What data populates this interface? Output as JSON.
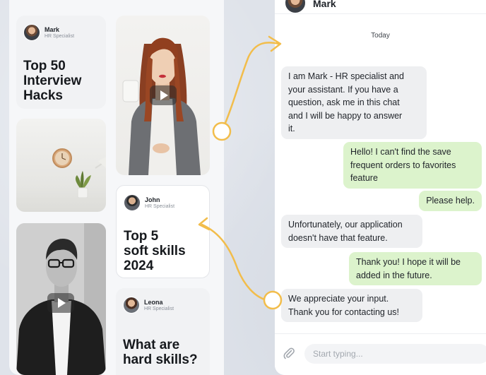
{
  "feed": {
    "cards": {
      "mark": {
        "author_name": "Mark",
        "author_role": "HR Specialist",
        "title_lines": [
          "Top 50",
          "Interview",
          "Hacks"
        ]
      },
      "john": {
        "author_name": "John",
        "author_role": "HR Specialist",
        "title_lines": [
          "Top 5",
          "soft skills",
          "2024"
        ]
      },
      "leona": {
        "author_name": "Leona",
        "author_role": "HR Specialist",
        "title_lines": [
          "What are",
          "hard skills?"
        ]
      }
    },
    "icons": {
      "play": "play-icon"
    }
  },
  "chat": {
    "header_name": "Mark",
    "day_label": "Today",
    "messages": [
      {
        "direction": "in",
        "lines": [
          "I am Mark - HR specialist and",
          "your assistant. If you have a",
          "question, ask me in this chat",
          "and I will be happy to answer",
          "it."
        ]
      },
      {
        "direction": "out",
        "lines": [
          "Hello! I can't find the save",
          "frequent orders to favorites",
          "feature"
        ]
      },
      {
        "direction": "out",
        "lines": [
          "Please help."
        ]
      },
      {
        "direction": "in",
        "lines": [
          "Unfortunately, our application",
          "doesn't have that feature."
        ]
      },
      {
        "direction": "out",
        "lines": [
          "Thank you! I hope it will be",
          "added in the future."
        ]
      },
      {
        "direction": "in",
        "lines": [
          "We appreciate your input.",
          "Thank you for contacting us!"
        ]
      }
    ],
    "composer": {
      "placeholder": "Start typing...",
      "value": ""
    }
  },
  "colors": {
    "connector": "#f2bd4b",
    "incoming_bubble": "#eeeff1",
    "outgoing_bubble": "#dcf3cc",
    "text_dark": "#1f2329"
  }
}
